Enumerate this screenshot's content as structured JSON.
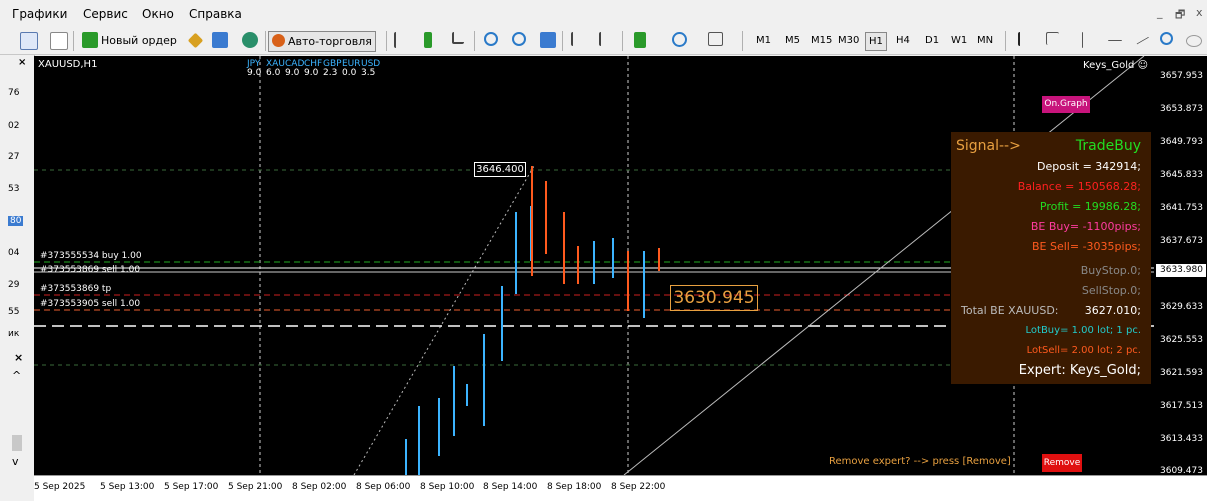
{
  "menu": {
    "items": [
      "Графики",
      "Сервис",
      "Окно",
      "Справка"
    ],
    "win_controls": [
      "_",
      "🗗",
      "x"
    ]
  },
  "toolbar": {
    "new_order": "Новый ордер",
    "auto_trading": "Авто-торговля",
    "timeframes": [
      "M1",
      "M5",
      "M15",
      "M30",
      "H1",
      "H4",
      "D1",
      "W1",
      "MN"
    ],
    "selected_timeframe": "H1"
  },
  "left_panel": {
    "numbers": [
      "76",
      "02",
      "27",
      "53",
      "80",
      "04",
      "29",
      "55",
      "ик"
    ]
  },
  "chart": {
    "symbol": "XAUUSD,H1",
    "currencies": [
      "JPY",
      "XAU",
      "CAD",
      "CHF",
      "GBP",
      "EUR",
      "USD"
    ],
    "currency_values": [
      "9.0",
      "6.0",
      "9.0",
      "9.0",
      "2.3",
      "0.0",
      "3.5"
    ],
    "keys_label": "Keys_Gold",
    "on_graph_button": "On.Graph",
    "remove_button": "Remove",
    "remove_message": "Remove expert? --> press [Remove]",
    "high_label": "3646.400",
    "price_box": "3630.945",
    "order_labels": [
      "#373555534 buy 1.00",
      "#373553869 sell 1.00",
      "#373553869 tp",
      "#373553905 sell 1.00"
    ]
  },
  "info_panel": {
    "signal": "Signal-->",
    "trade": "TradeBuy",
    "deposit": "Deposit = 342914;",
    "balance": "Balance = 150568.28;",
    "profit": "Profit = 19986.28;",
    "be_buy": "BE Buy= -1100pips;",
    "be_sell": "BE Sell= -3035pips;",
    "buystop": "BuyStop.0;",
    "sellstop": "SellStop.0;",
    "total_be_label": "Total BE XAUUSD:",
    "total_be_value": "3627.010;",
    "lot_buy": "LotBuy= 1.00 lot; 1 pc.",
    "lot_sell": "LotSell= 2.00 lot; 2 pc.",
    "expert": "Expert: Keys_Gold;"
  },
  "price_scale": {
    "labels": [
      "3657.953",
      "3653.873",
      "3649.793",
      "3645.833",
      "3641.753",
      "3637.673",
      "3633.980",
      "3629.633",
      "3625.553",
      "3621.593",
      "3617.513",
      "3613.433",
      "3609.473"
    ],
    "current": "3633.980"
  },
  "time_scale": {
    "labels": [
      "5 Sep 2025",
      "5 Sep 13:00",
      "5 Sep 17:00",
      "5 Sep 21:00",
      "8 Sep 02:00",
      "8 Sep 06:00",
      "8 Sep 10:00",
      "8 Sep 14:00",
      "8 Sep 18:00",
      "8 Sep 22:00"
    ]
  },
  "colors": {
    "buy": "#3cb4ff",
    "sell": "#ff5a1e",
    "panel_bg": "#3a1a00",
    "signal": "#e8a040",
    "trade": "#22dd22",
    "balance": "#ff2020",
    "pink": "#ff3ca0",
    "cyan": "#22cccc"
  }
}
